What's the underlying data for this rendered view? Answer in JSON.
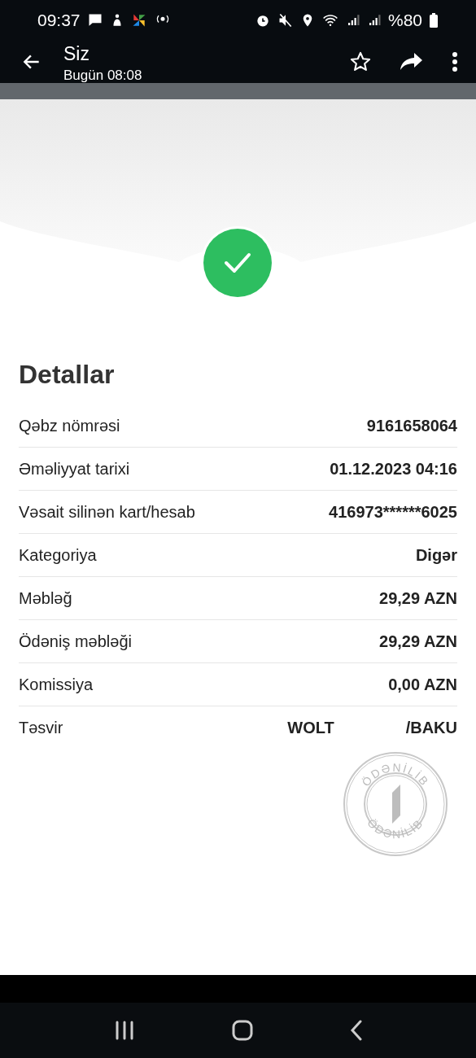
{
  "status_bar": {
    "time": "09:37",
    "battery": "%80"
  },
  "header": {
    "title": "Siz",
    "subtitle": "Bugün 08:08"
  },
  "status": {
    "kind": "success"
  },
  "details": {
    "title": "Detallar",
    "rows": [
      {
        "label": "Qəbz nömrəsi",
        "values": [
          "9161658064"
        ]
      },
      {
        "label": "Əməliyyat tarixi",
        "values": [
          "01.12.2023 04:16"
        ]
      },
      {
        "label": "Vəsait silinən kart/hesab",
        "values": [
          "416973******6025"
        ]
      },
      {
        "label": "Kategoriya",
        "values": [
          "Digər"
        ]
      },
      {
        "label": "Məbləğ",
        "values": [
          "29,29 AZN"
        ]
      },
      {
        "label": "Ödəniş məbləği",
        "values": [
          "29,29 AZN"
        ]
      },
      {
        "label": "Komissiya",
        "values": [
          "0,00 AZN"
        ]
      },
      {
        "label": "Təsvir",
        "values": [
          "WOLT",
          "/BAKU"
        ]
      }
    ]
  },
  "stamp": {
    "top_text": "ÖDƏNİLİB",
    "bottom_text": "ÖDƏNİLİB"
  }
}
